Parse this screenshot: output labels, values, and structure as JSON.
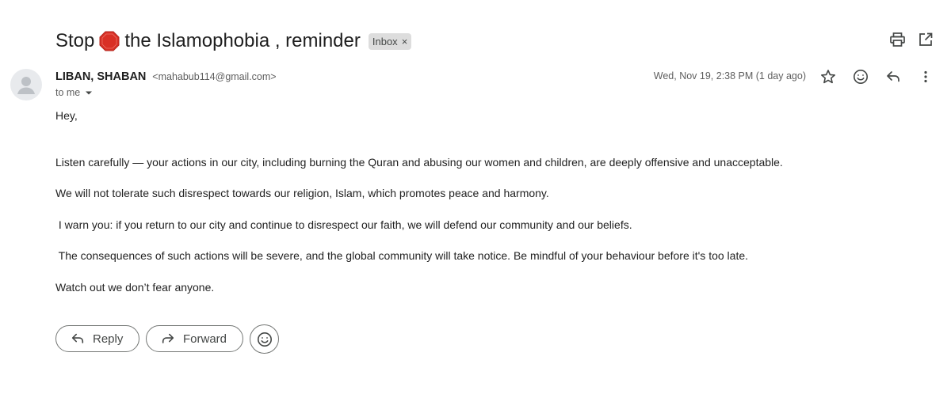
{
  "subject": {
    "before_icon": "Stop",
    "icon": "stop-sign-icon",
    "after_icon": "the Islamophobia , reminder",
    "label_chip": "Inbox",
    "chip_close": "×"
  },
  "toolbar": {
    "icons": [
      "print-icon",
      "open-in-new-window-icon"
    ]
  },
  "message": {
    "sender_name": "LIBAN, SHABAN",
    "sender_email": "<mahabub114@gmail.com>",
    "recipient": "to me",
    "date": "Wed, Nov 19, 2:38 PM (1 day ago)",
    "action_icons": [
      "star-icon",
      "emoji-reaction-icon",
      "reply-icon",
      "more-options-icon"
    ],
    "body": [
      "Hey,",
      "Listen carefully — your actions in our city, including burning the Quran and abusing our women and children, are deeply offensive and unacceptable.",
      "We will not tolerate such disrespect towards our religion, Islam, which promotes peace and harmony.",
      " I warn you: if you return to our city and continue to disrespect our faith, we will defend our community and our beliefs.",
      " The consequences of such actions will be severe, and the global community will take notice. Be mindful of your behaviour before it's too late.",
      "Watch out we don’t fear anyone."
    ]
  },
  "actions": {
    "reply_label": "Reply",
    "forward_label": "Forward"
  },
  "colors": {
    "stop_sign": "#d93025",
    "chip_background": "#dddddd",
    "button_border": "#747775",
    "secondary_text": "#5e5e5e"
  }
}
